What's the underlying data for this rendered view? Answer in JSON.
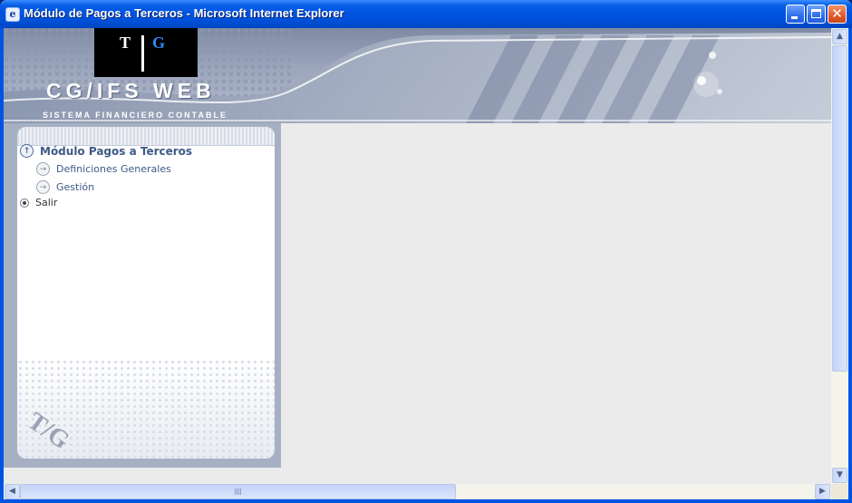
{
  "window": {
    "title": "Módulo de Pagos a Terceros - Microsoft Internet Explorer",
    "app_icon": "internet-explorer-icon",
    "controls": [
      "minimize-icon",
      "maximize-icon",
      "close-icon"
    ]
  },
  "banner": {
    "logo_letter_left": "T",
    "logo_letter_right": "G",
    "brand": "CG/IFS WEB",
    "subtitle": "SISTEMA FINANCIERO CONTABLE"
  },
  "menu": {
    "main": "Módulo Pagos a Terceros",
    "items": [
      {
        "label": "Definiciones Generales",
        "icon": "arrow-right-icon"
      },
      {
        "label": "Gestión",
        "icon": "arrow-right-icon"
      }
    ],
    "exit": "Salir"
  },
  "panel_mark": "T/G",
  "colors": {
    "titlebar": "#0054e3",
    "banner": "#9aa4bb",
    "menu_text": "#3d5a86",
    "content_bg": "#ebebeb"
  }
}
